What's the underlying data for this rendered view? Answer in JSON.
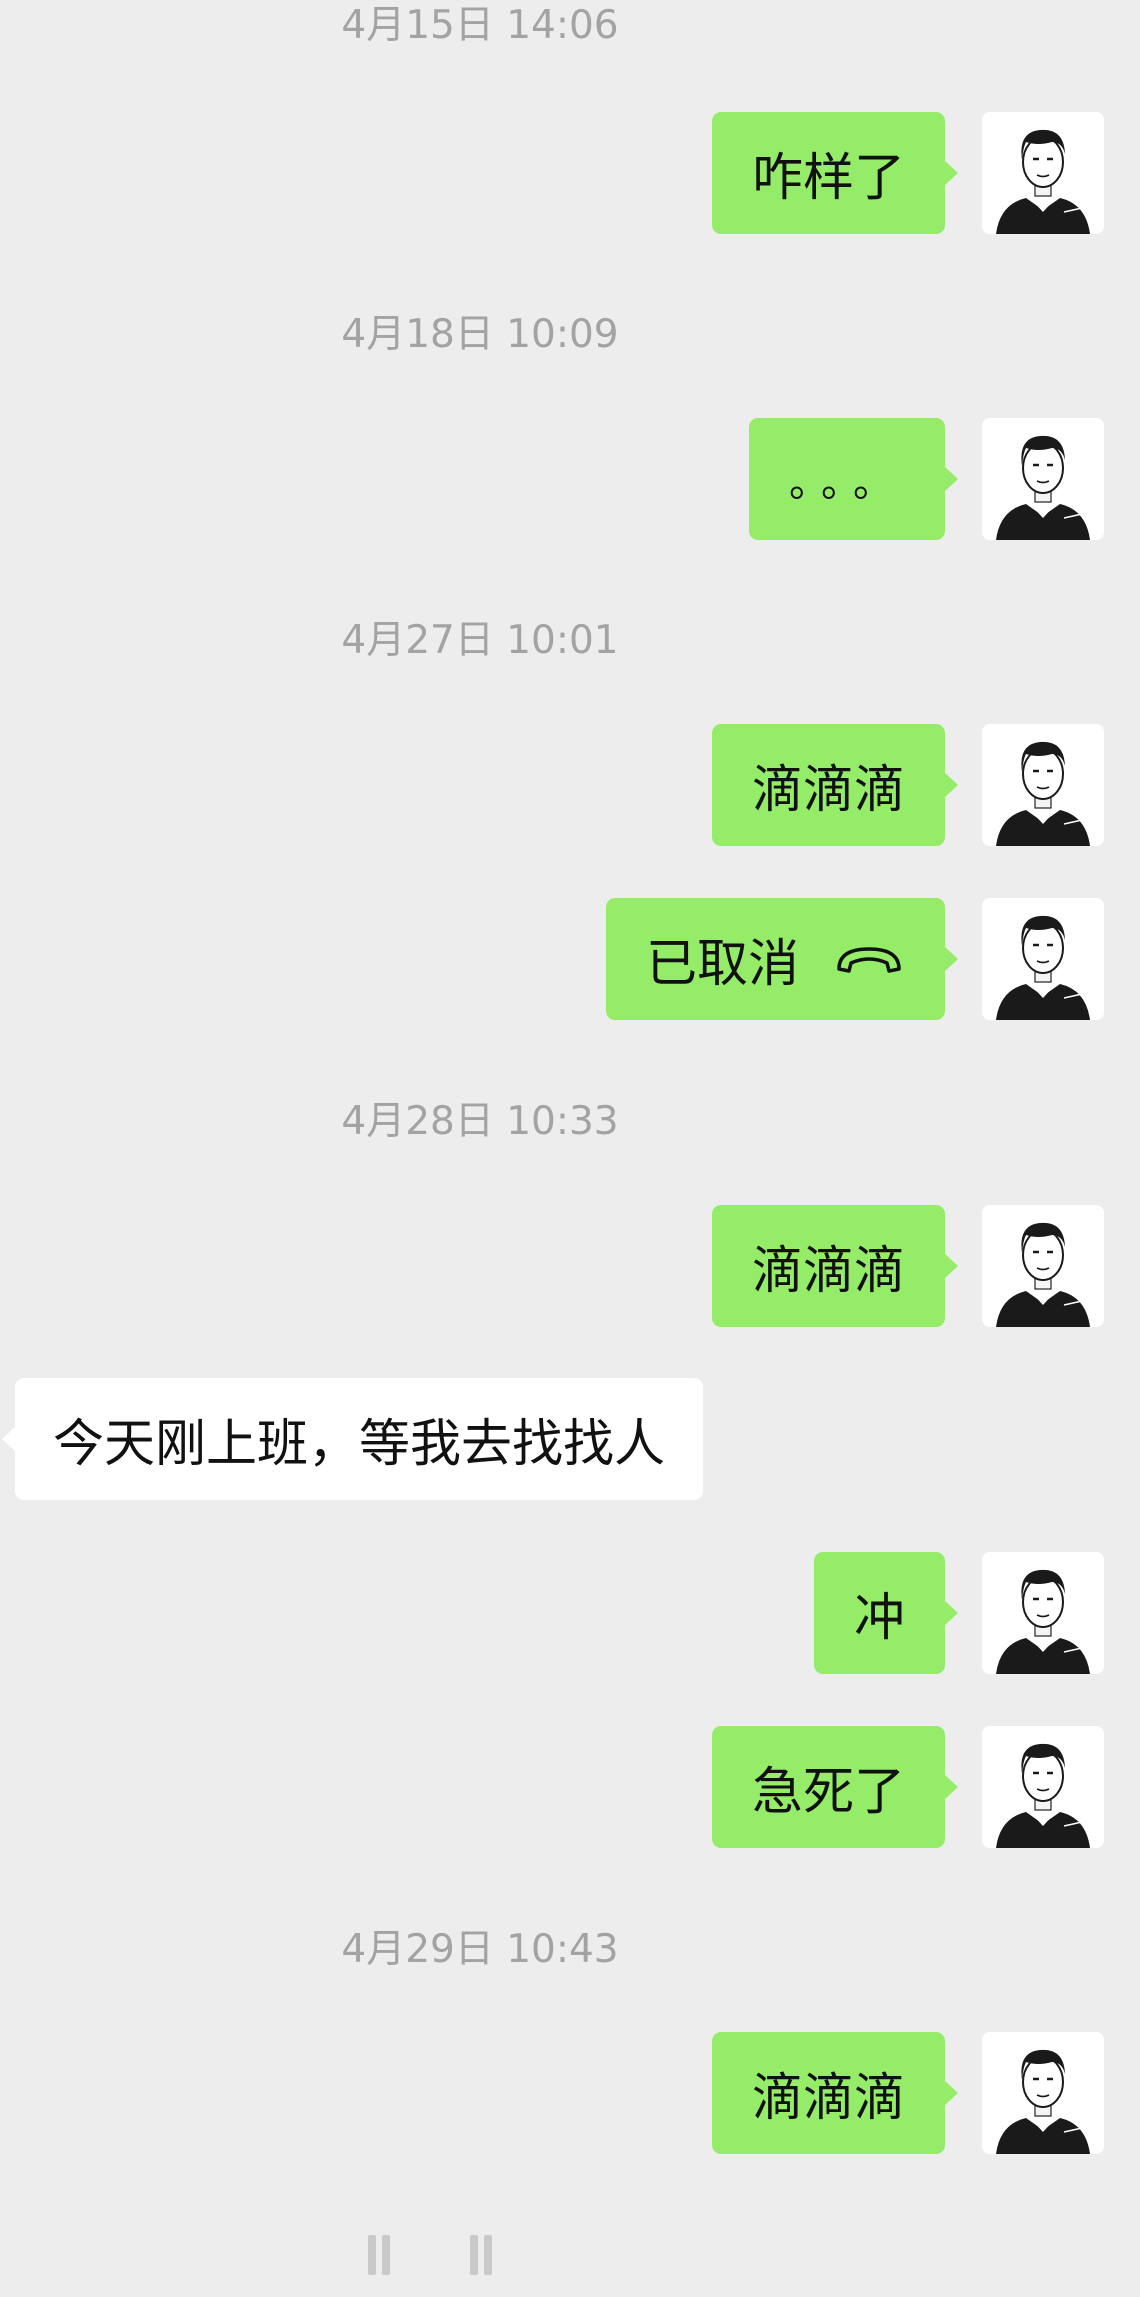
{
  "colors": {
    "background": "#ededed",
    "my_bubble": "#95ec69",
    "their_bubble": "#ffffff",
    "timestamp": "#a3a3a3"
  },
  "messages": [
    {
      "time": "4月15日 14:06"
    },
    {
      "from": "me",
      "text": "咋样了"
    },
    {
      "time": "4月18日 10:09"
    },
    {
      "from": "me",
      "text": "。。。"
    },
    {
      "time": "4月27日 10:01"
    },
    {
      "from": "me",
      "text": "滴滴滴"
    },
    {
      "from": "me",
      "text": "已取消",
      "icon": "phone-hangup-icon"
    },
    {
      "time": "4月28日 10:33"
    },
    {
      "from": "me",
      "text": "滴滴滴"
    },
    {
      "from": "other",
      "text": "今天刚上班，等我去找找人"
    },
    {
      "from": "me",
      "text": "冲"
    },
    {
      "from": "me",
      "text": "急死了"
    },
    {
      "time": "4月29日 10:43"
    },
    {
      "from": "me",
      "text": "滴滴滴"
    }
  ]
}
